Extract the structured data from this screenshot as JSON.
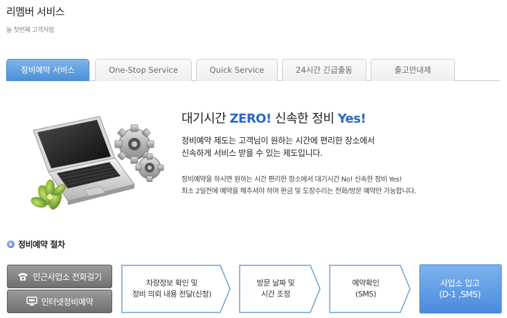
{
  "header": {
    "title": "리멤버 서비스",
    "subtitle": "늘 첫번째 고객처럼"
  },
  "tabs": [
    {
      "label": "정비예약 서비스",
      "active": true
    },
    {
      "label": "One-Stop Service",
      "active": false
    },
    {
      "label": "Quick Service",
      "active": false
    },
    {
      "label": "24시간 긴급출동",
      "active": false
    },
    {
      "label": "출고안내제",
      "active": false
    }
  ],
  "intro": {
    "headline_part1": "대기시간 ",
    "headline_accent1": "ZERO!",
    "headline_part2": " 신속한 정비 ",
    "headline_accent2": "Yes!",
    "desc_line1": "정비예약 제도는 고객님이 원하는 시간에 편리한 장소에서",
    "desc_line2": "신속하게 서비스 받을 수 있는 제도입니다.",
    "note_line1": "정비예약을 하시면 원하는 시간 편리한 장소에서 대기시간 No! 신속한 정비 Yes!",
    "note_line2": "최소 2일전에 예약을 해주셔야 하며 판금 및 도장수리는 전화/방문 예약만 가능합니다."
  },
  "procedure": {
    "title": "정비예약 절차",
    "call_button": "인근사업소 전화걸기",
    "web_button": "인터넷정비예약",
    "steps": [
      {
        "line1": "차량정보 확인 및",
        "line2": "정비 의뢰 내용 전달(신청)"
      },
      {
        "line1": "방문 날짜 및",
        "line2": "시간 조정"
      },
      {
        "line1": "예약확인",
        "line2": "(SMS)"
      },
      {
        "line1": "사업소 입고",
        "line2": "(D-1 ,SMS)"
      }
    ]
  },
  "colors": {
    "accent_blue": "#2a66c8",
    "tab_active": "#5a9be0",
    "final_step": "#5b9de6",
    "button_gray": "#7f7f7f"
  }
}
